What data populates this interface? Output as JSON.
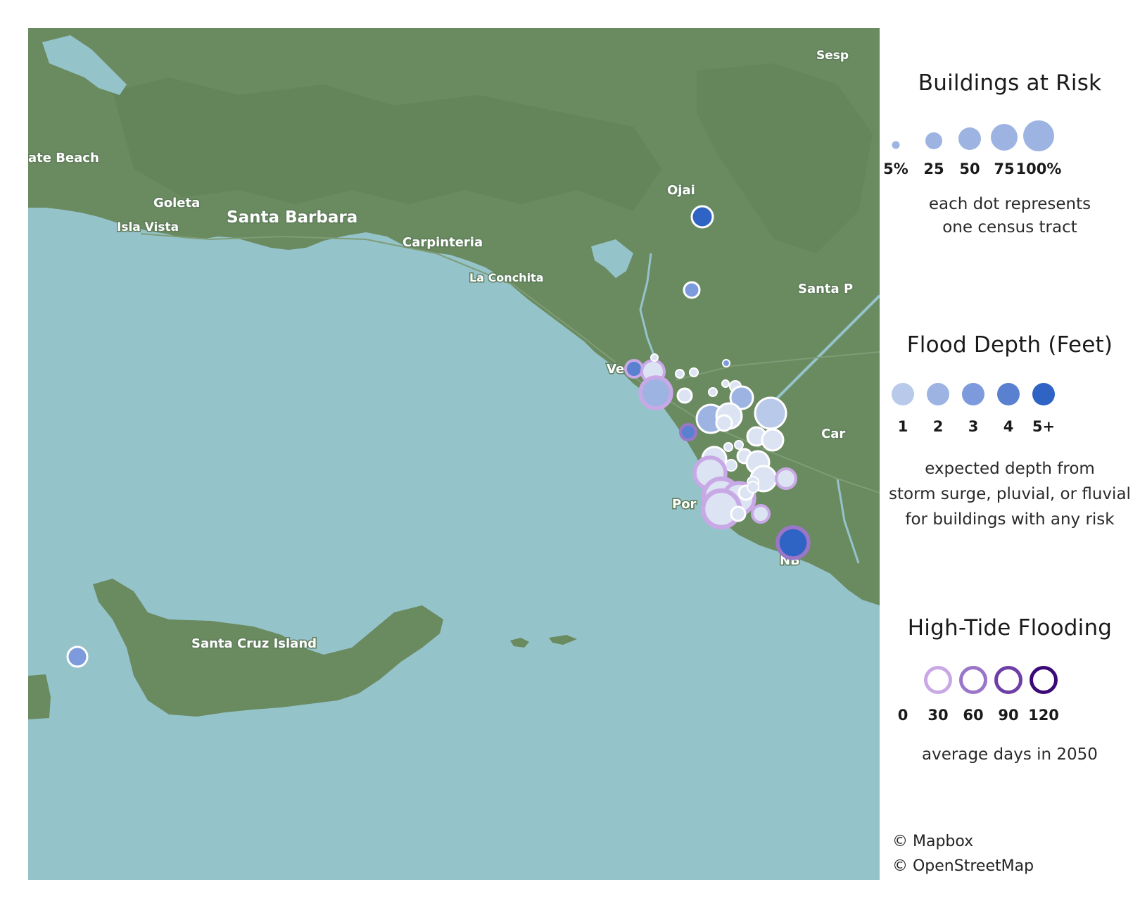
{
  "map": {
    "place_labels": {
      "ate_beach": "ate Beach",
      "goleta": "Goleta",
      "isla_vista": "Isla Vista",
      "santa_barbara": "Santa Barbara",
      "carpinteria": "Carpinteria",
      "la_conchita": "La Conchita",
      "ojai": "Ojai",
      "santa_p": "Santa P",
      "sesp": "Sesp",
      "ve": "Ve",
      "car": "Car",
      "por": "Por",
      "nb": "NB",
      "santa_cruz_island": "Santa Cruz Island"
    },
    "colors": {
      "ocean": "#95c3ca",
      "land": "#6a8a60",
      "depth_1": "#b8c9ea",
      "depth_2": "#9db4e3",
      "depth_3": "#7d9bdc",
      "depth_4": "#5a80d0",
      "depth_5": "#2f63c4",
      "tide_30": "#c9a8e6",
      "tide_60": "#9a76c9",
      "tide_90": "#6f3fa8",
      "tide_120": "#3b0a78",
      "pale_fill": "#dce3f3"
    }
  },
  "legend": {
    "buildings": {
      "title": "Buildings at Risk",
      "labels": [
        "5%",
        "25",
        "50",
        "75",
        "100%"
      ],
      "percent_values": [
        5,
        25,
        50,
        75,
        100
      ],
      "note_line1": "each dot represents",
      "note_line2": "one census tract"
    },
    "depth": {
      "title": "Flood Depth (Feet)",
      "labels": [
        "1",
        "2",
        "3",
        "4",
        "5+"
      ],
      "note_line1": "expected depth from",
      "note_line2": "storm surge, pluvial, or fluvial",
      "note_line3": "for buildings with any risk"
    },
    "tide": {
      "title": "High-Tide Flooding",
      "labels": [
        "0",
        "30",
        "60",
        "90",
        "120"
      ],
      "note_line1": "average days in 2050"
    }
  },
  "credits": {
    "mapbox": "© Mapbox",
    "osm": "© OpenStreetMap"
  }
}
